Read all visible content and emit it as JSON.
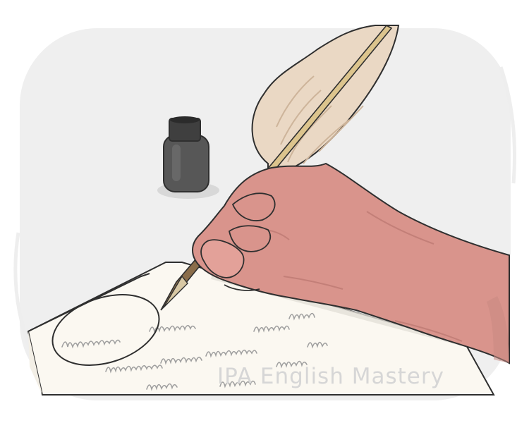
{
  "watermark": {
    "text": "IPA English Mastery"
  },
  "illustration": {
    "subject": "hand writing with a quill pen beside an ink bottle",
    "colors": {
      "panel": "#efefef",
      "feather": "#ead8c4",
      "feather_shadow": "#cdb49a",
      "quill_shaft": "#dcc48d",
      "hand": "#d9948c",
      "hand_shadow": "#c37f78",
      "ink_bottle": "#575757",
      "ink_cap": "#3f3f3f",
      "paper": "#fbf8f1",
      "paper_shadow": "#e9e5de",
      "handwriting": "#9f9f9f",
      "outline": "#2f2f2f"
    }
  }
}
